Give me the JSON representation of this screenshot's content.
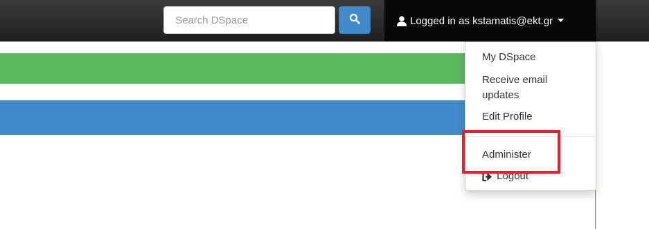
{
  "search": {
    "placeholder": "Search DSpace"
  },
  "user_menu": {
    "label": "Logged in as kstamatis@ekt.gr"
  },
  "dropdown": {
    "items": [
      {
        "label": "My DSpace"
      },
      {
        "label": "Receive email updates"
      },
      {
        "label": "Edit Profile"
      },
      {
        "label": "Administer"
      },
      {
        "label": "Logout"
      }
    ]
  },
  "icons": {
    "search": "search-icon",
    "user": "user-icon",
    "caret": "caret-down-icon",
    "logout": "logout-icon"
  },
  "colors": {
    "navbar": "#222222",
    "primary": "#428bca",
    "success": "#5cb85c",
    "highlight": "#e8202a"
  }
}
